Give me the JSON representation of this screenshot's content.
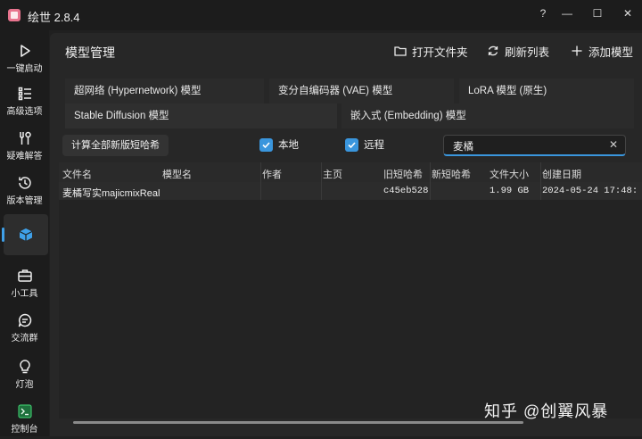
{
  "app": {
    "title": "绘世 2.8.4"
  },
  "window_controls": {
    "help": "?",
    "minimize": "—",
    "maximize": "☐",
    "close": "✕"
  },
  "sidebar": {
    "items": [
      {
        "label": "一键启动",
        "icon": "play-icon"
      },
      {
        "label": "高级选项",
        "icon": "options-list-icon"
      },
      {
        "label": "疑难解答",
        "icon": "wrench-icon"
      },
      {
        "label": "版本管理",
        "icon": "history-icon"
      },
      {
        "label": "",
        "icon": "cube-icon"
      },
      {
        "label": "小工具",
        "icon": "toolbox-icon"
      },
      {
        "label": "交流群",
        "icon": "chat-icon"
      },
      {
        "label": "灯泡",
        "icon": "lightbulb-icon"
      },
      {
        "label": "控制台",
        "icon": "console-icon"
      }
    ]
  },
  "header": {
    "title": "模型管理",
    "open_folder": "打开文件夹",
    "refresh": "刷新列表",
    "add_model": "添加模型"
  },
  "tabs": [
    "超网络 (Hypernetwork) 模型",
    "变分自编码器 (VAE) 模型",
    "LoRA 模型 (原生)",
    "Stable Diffusion 模型",
    "嵌入式 (Embedding) 模型"
  ],
  "toolbar": {
    "calc_button": "计算全部新版短哈希",
    "local_label": "本地",
    "remote_label": "远程",
    "search_value": "麦橘"
  },
  "table": {
    "columns": [
      "文件名",
      "模型名",
      "作者",
      "主页",
      "旧短哈希",
      "新短哈希",
      "文件大小",
      "创建日期"
    ],
    "rows": [
      [
        "麦橘写实majicmixRealis",
        "",
        "",
        "",
        "c45eb528",
        "",
        "1.99 GB",
        "2024-05-24 17:48:"
      ]
    ]
  },
  "watermark": "知乎 @创翼风暴",
  "colors": {
    "accent": "#3a96dd",
    "background": "#202020",
    "panel": "#272727"
  }
}
